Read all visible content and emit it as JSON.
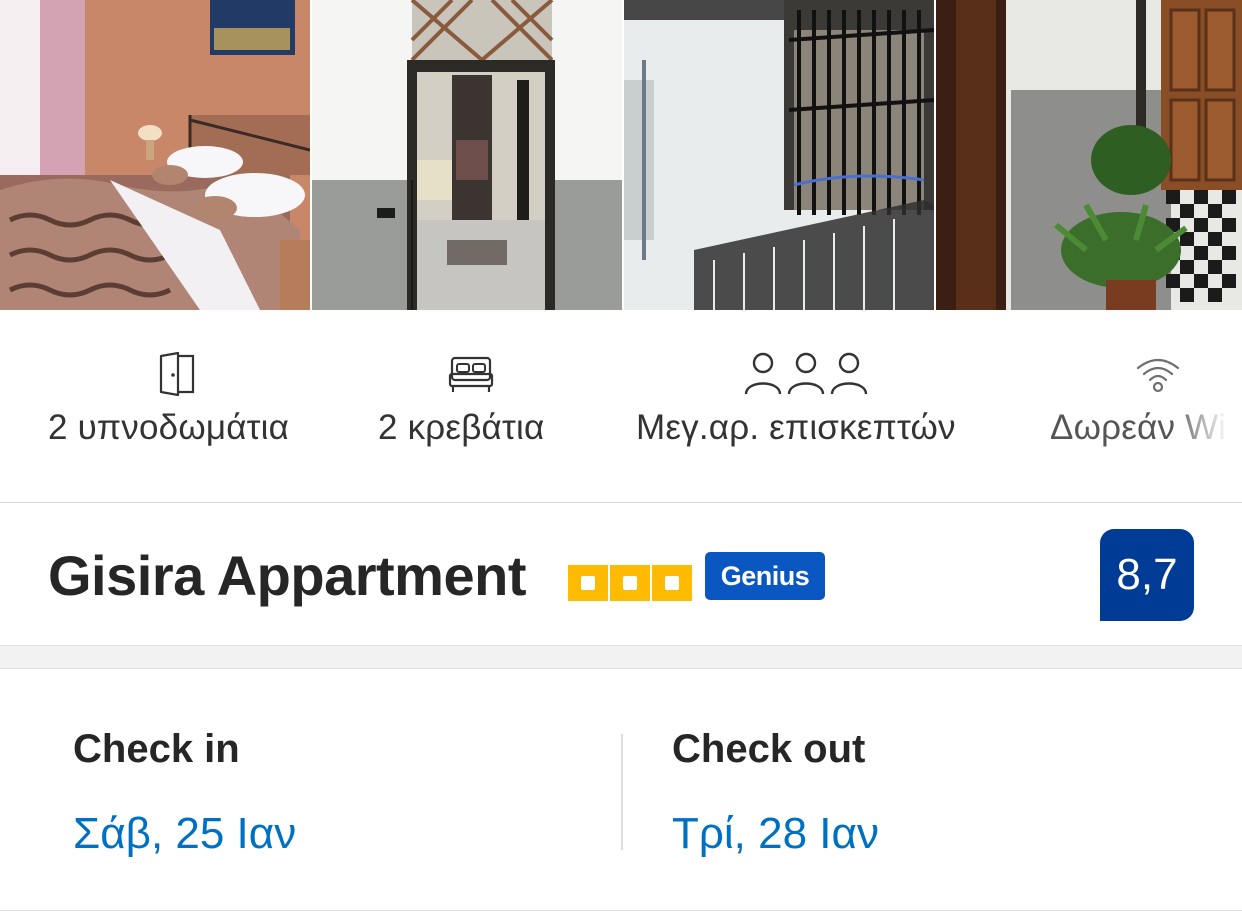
{
  "photos": [
    {
      "name": "bedroom"
    },
    {
      "name": "entrance-doorway"
    },
    {
      "name": "balcony-with-bars"
    },
    {
      "name": "courtyard-with-plants"
    }
  ],
  "facilities": [
    {
      "icon": "door-icon",
      "label": "2 υπνοδωμάτια"
    },
    {
      "icon": "bed-icon",
      "label": "2 κρεβάτια"
    },
    {
      "icon": "guests-icon",
      "label": "Μεγ.αρ. επισκεπτών"
    },
    {
      "icon": "wifi-icon",
      "label": "Δωρεάν Wi"
    }
  ],
  "property": {
    "name": "Gisira Appartment",
    "stars": 3,
    "genius_badge": "Genius",
    "score": "8,7"
  },
  "dates": {
    "checkin_label": "Check in",
    "checkin_value": "Σάβ, 25 Ιαν",
    "checkout_label": "Check out",
    "checkout_value": "Τρί, 28 Ιαν"
  },
  "colors": {
    "link_blue": "#0071c2",
    "genius_blue": "#0a57c2",
    "score_blue": "#003b95",
    "star_yellow": "#febb02"
  }
}
